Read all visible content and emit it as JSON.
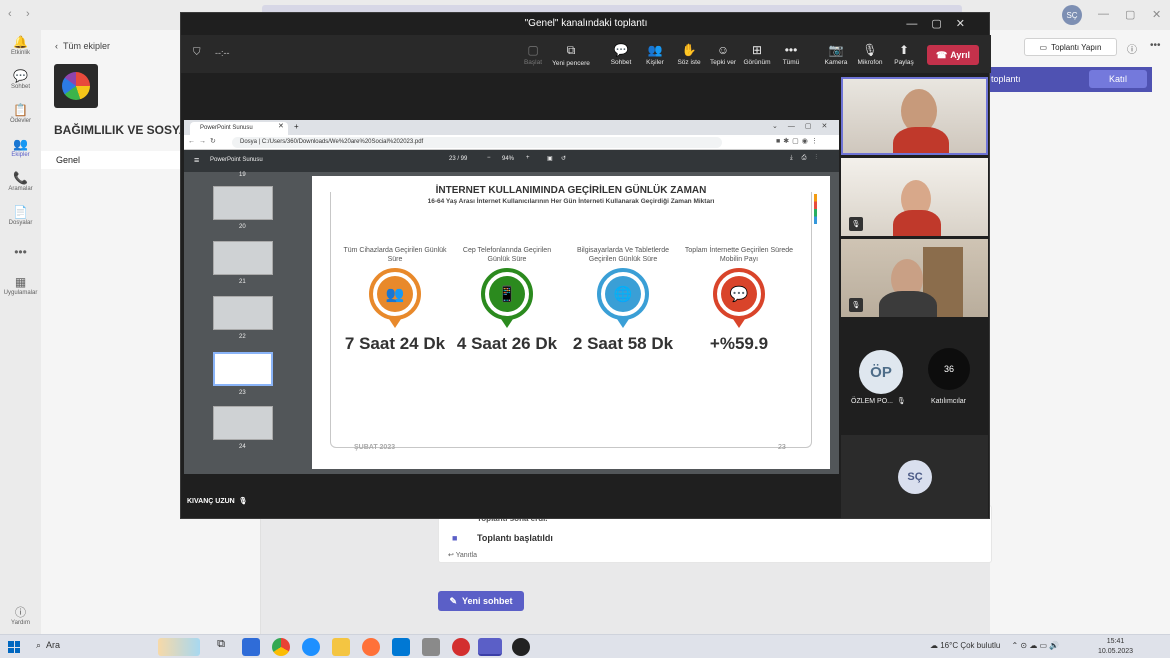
{
  "teams": {
    "back_label": "Tüm ekipler",
    "team_name": "BAĞIMLILIK VE SOSYAL M",
    "channel": "Genel",
    "meet_button": "Toplantı Yapın",
    "join_banner": "toplantı",
    "join_button": "Katıl",
    "chat_ended": "Toplantı sona erdi.",
    "chat_started": "Toplantı başlatıldı",
    "reply": "Yanıtla",
    "new_chat": "Yeni sohbet",
    "user_initials": "SÇ"
  },
  "rail": [
    {
      "label": "Etkinlik",
      "icon": "bell-icon",
      "glyph": "🔔"
    },
    {
      "label": "Sohbet",
      "icon": "chat-icon",
      "glyph": "💬"
    },
    {
      "label": "Ödevler",
      "icon": "assignment-icon",
      "glyph": "📋"
    },
    {
      "label": "Ekipler",
      "icon": "teams-icon",
      "glyph": "👥"
    },
    {
      "label": "Aramalar",
      "icon": "phone-icon",
      "glyph": "📞"
    },
    {
      "label": "Dosyalar",
      "icon": "file-icon",
      "glyph": "📄"
    },
    {
      "label": "",
      "icon": "more-icon",
      "glyph": "•••"
    },
    {
      "label": "Uygulamalar",
      "icon": "apps-icon",
      "glyph": "▦"
    }
  ],
  "help_label": "Yardım",
  "meeting": {
    "title": "\"Genel\" kanalındaki toplantı",
    "timer": "--:--",
    "toolbar": [
      {
        "label": "Başlat",
        "icon": "start-icon",
        "glyph": "▢",
        "dim": true
      },
      {
        "label": "Yeni pencere",
        "icon": "new-window-icon",
        "glyph": "⧉",
        "dim": false
      },
      {
        "label": "Sohbet",
        "icon": "chat-icon",
        "glyph": "💬",
        "dim": false
      },
      {
        "label": "Kişiler",
        "icon": "people-icon",
        "glyph": "👥",
        "dim": false
      },
      {
        "label": "Söz iste",
        "icon": "raise-hand-icon",
        "glyph": "✋",
        "dim": false
      },
      {
        "label": "Tepki ver",
        "icon": "reaction-icon",
        "glyph": "☺",
        "dim": false
      },
      {
        "label": "Görünüm",
        "icon": "view-icon",
        "glyph": "⊞",
        "dim": false
      },
      {
        "label": "Tümü",
        "icon": "more-icon",
        "glyph": "•••",
        "dim": false
      },
      {
        "label": "Kamera",
        "icon": "camera-off-icon",
        "glyph": "📷",
        "dim": false
      },
      {
        "label": "Mikrofon",
        "icon": "mic-off-icon",
        "glyph": "🎙",
        "dim": false
      },
      {
        "label": "Paylaş",
        "icon": "share-icon",
        "glyph": "⬆",
        "dim": false
      }
    ],
    "leave": "Ayrıl",
    "presenter": "KIVANÇ UZUN"
  },
  "browser": {
    "tab_title": "PowerPoint Sunusu",
    "url": "Dosya | C:/Users/360/Downloads/We%20are%20Social%202023.pdf",
    "pdf_title": "PowerPoint Sunusu",
    "page": "23 / 99",
    "zoom": "94%",
    "thumb_numbers": [
      "19",
      "20",
      "21",
      "22",
      "23",
      "24"
    ]
  },
  "slide": {
    "title": "İNTERNET KULLANIMINDA GEÇİRİLEN GÜNLÜK ZAMAN",
    "subtitle": "16-64 Yaş Arası İnternet Kullanıcılarının Her Gün İnterneti Kullanarak Geçirdiği Zaman Miktarı",
    "columns": [
      {
        "label": "Tüm Cihazlarda Geçirilen Günlük Süre",
        "value": "7 Saat 24 Dk",
        "color": "#e8892b",
        "icon": "people-group-icon",
        "glyph": "👥"
      },
      {
        "label": "Cep Telefonlarında Geçirilen Günlük Süre",
        "value": "4 Saat 26 Dk",
        "color": "#2b8a1e",
        "icon": "mobile-phone-icon",
        "glyph": "📱"
      },
      {
        "label": "Bilgisayarlarda Ve Tabletlerde Geçirilen Günlük Süre",
        "value": "2 Saat 58 Dk",
        "color": "#3a9fd6",
        "icon": "globe-icon",
        "glyph": "🌐"
      },
      {
        "label": "Toplam İnternette Geçirilen Sürede Mobilin Payı",
        "value": "+%59.9",
        "color": "#d9442a",
        "icon": "chat-bubble-icon",
        "glyph": "💬"
      }
    ],
    "date": "ŞUBAT 2023",
    "number": "23"
  },
  "participants": {
    "op_initials": "ÖP",
    "op_name": "ÖZLEM PO...",
    "count": "36",
    "count_label": "Katılımcılar",
    "sc_initials": "SÇ"
  },
  "taskbar": {
    "search": "Ara",
    "weather": "16°C  Çok bulutlu",
    "time": "15:41",
    "date": "10.05.2023"
  }
}
